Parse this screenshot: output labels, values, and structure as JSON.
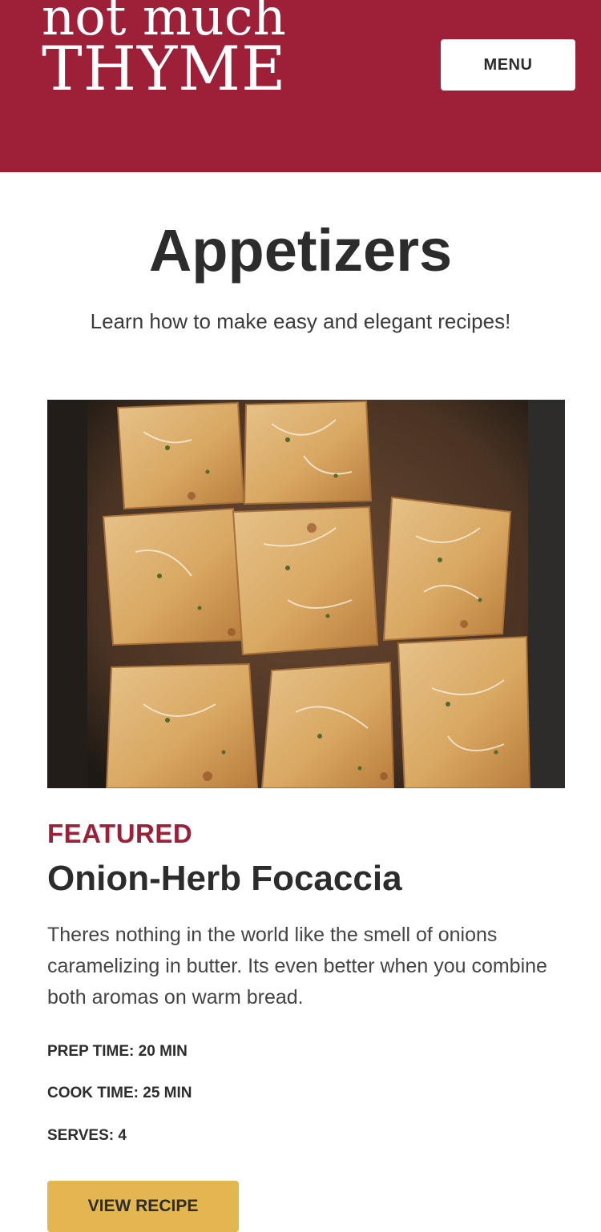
{
  "header": {
    "logo_line1": "not much",
    "logo_line2": "THYME",
    "menu_label": "MENU",
    "brand_color": "#9d1f38"
  },
  "page": {
    "title": "Appetizers",
    "subtitle": "Learn how to make easy and elegant recipes!"
  },
  "featured": {
    "eyebrow": "FEATURED",
    "title": "Onion-Herb Focaccia",
    "description": "Theres nothing in the world like the smell of onions caramelizing in butter. Its even better when you combine both aromas on warm bread.",
    "prep_time": "PREP TIME: 20 MIN",
    "cook_time": "COOK TIME: 25 MIN",
    "serves": "SERVES: 4",
    "button_label": "VIEW RECIPE",
    "button_color": "#e3b650"
  }
}
